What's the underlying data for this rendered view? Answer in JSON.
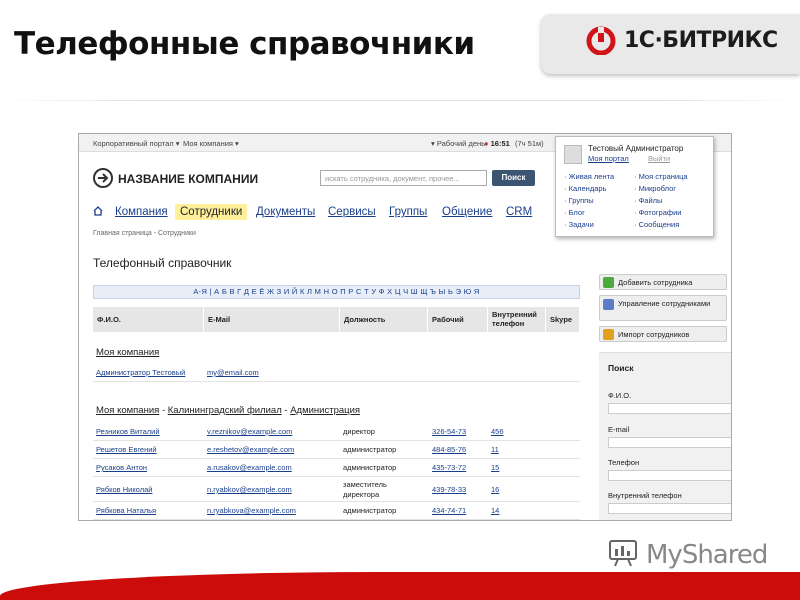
{
  "slide": {
    "title": "Телефонные справочники",
    "brand": "1С·БИТРИКС",
    "watermark": "MyShared"
  },
  "topbar": {
    "portal": "Корпоративный портал",
    "my_company": "Моя компания",
    "workday": "Рабочий день:",
    "time": "16:51",
    "time_extra": "(7ч 51м)"
  },
  "header": {
    "company_name": "НАЗВАНИЕ КОМПАНИИ",
    "search_placeholder": "искать сотрудника, документ, прочее...",
    "search_button": "Поиск"
  },
  "nav": {
    "home_icon": "home-icon",
    "items": [
      "Компания",
      "Сотрудники",
      "Документы",
      "Сервисы",
      "Группы",
      "Общение",
      "CRM"
    ],
    "active": "Сотрудники"
  },
  "breadcrumb": "Главная страница - Сотрудники",
  "page_title": "Телефонный справочник",
  "alphabet": "А-Я | А Б В Г Д Е Ё Ж З И Й К Л М Н О П Р С Т У Ф Х Ц Ч Ш Щ Ъ Ы Ь Э Ю Я",
  "table": {
    "headers": [
      "Ф.И.О.",
      "E-Mail",
      "Должность",
      "Рабочий",
      "Внутренний телефон",
      "Skype"
    ],
    "group1": {
      "title": "Моя компания",
      "rows": [
        {
          "name": "Администратор Тестовый",
          "email": "my@email.com",
          "position": "",
          "work": "",
          "internal": ""
        }
      ]
    },
    "group2": {
      "parts": [
        "Моя компания",
        "Калининградский филиал",
        "Администрация"
      ],
      "sep": "-",
      "rows": [
        {
          "name": "Резников Виталий",
          "email": "v.reznikov@example.com",
          "position": "директор",
          "work": "326-54-73",
          "internal": "456"
        },
        {
          "name": "Решетов Евгений",
          "email": "e.reshetov@example.com",
          "position": "администратор",
          "work": "484-85-76",
          "internal": "11"
        },
        {
          "name": "Русаков Антон",
          "email": "a.rusakov@example.com",
          "position": "администратор",
          "work": "435-73-72",
          "internal": "15"
        },
        {
          "name": "Рябков Николай",
          "email": "n.ryabkov@example.com",
          "position": "заместитель директора",
          "work": "439-78-33",
          "internal": "16"
        },
        {
          "name": "Рябкова Наталья",
          "email": "n.ryabkova@example.com",
          "position": "администратор",
          "work": "434-74-71",
          "internal": "14"
        }
      ]
    }
  },
  "user_box": {
    "name": "Тестовый Администратор",
    "my_portal": "Моя портал",
    "logout": "Выйти",
    "menu_left": [
      "Живая лента",
      "Календарь",
      "Группы",
      "Блог",
      "Задачи"
    ],
    "menu_right": [
      "Моя страница",
      "Микроблог",
      "Файлы",
      "Фотографии",
      "Сообщения"
    ]
  },
  "sidebar": {
    "add_employee": "Добавить сотрудника",
    "manage_employees": "Управление сотрудниками",
    "import_employees": "Импорт сотрудников",
    "search_title": "Поиск",
    "fields": [
      "Ф.И.О.",
      "E-mail",
      "Телефон",
      "Внутренний телефон"
    ]
  },
  "colors": {
    "link": "#1a3f8a",
    "active_tab": "#ffef9b",
    "bottom_bar": "#cc0b0b",
    "brand_red": "#d0141a"
  }
}
